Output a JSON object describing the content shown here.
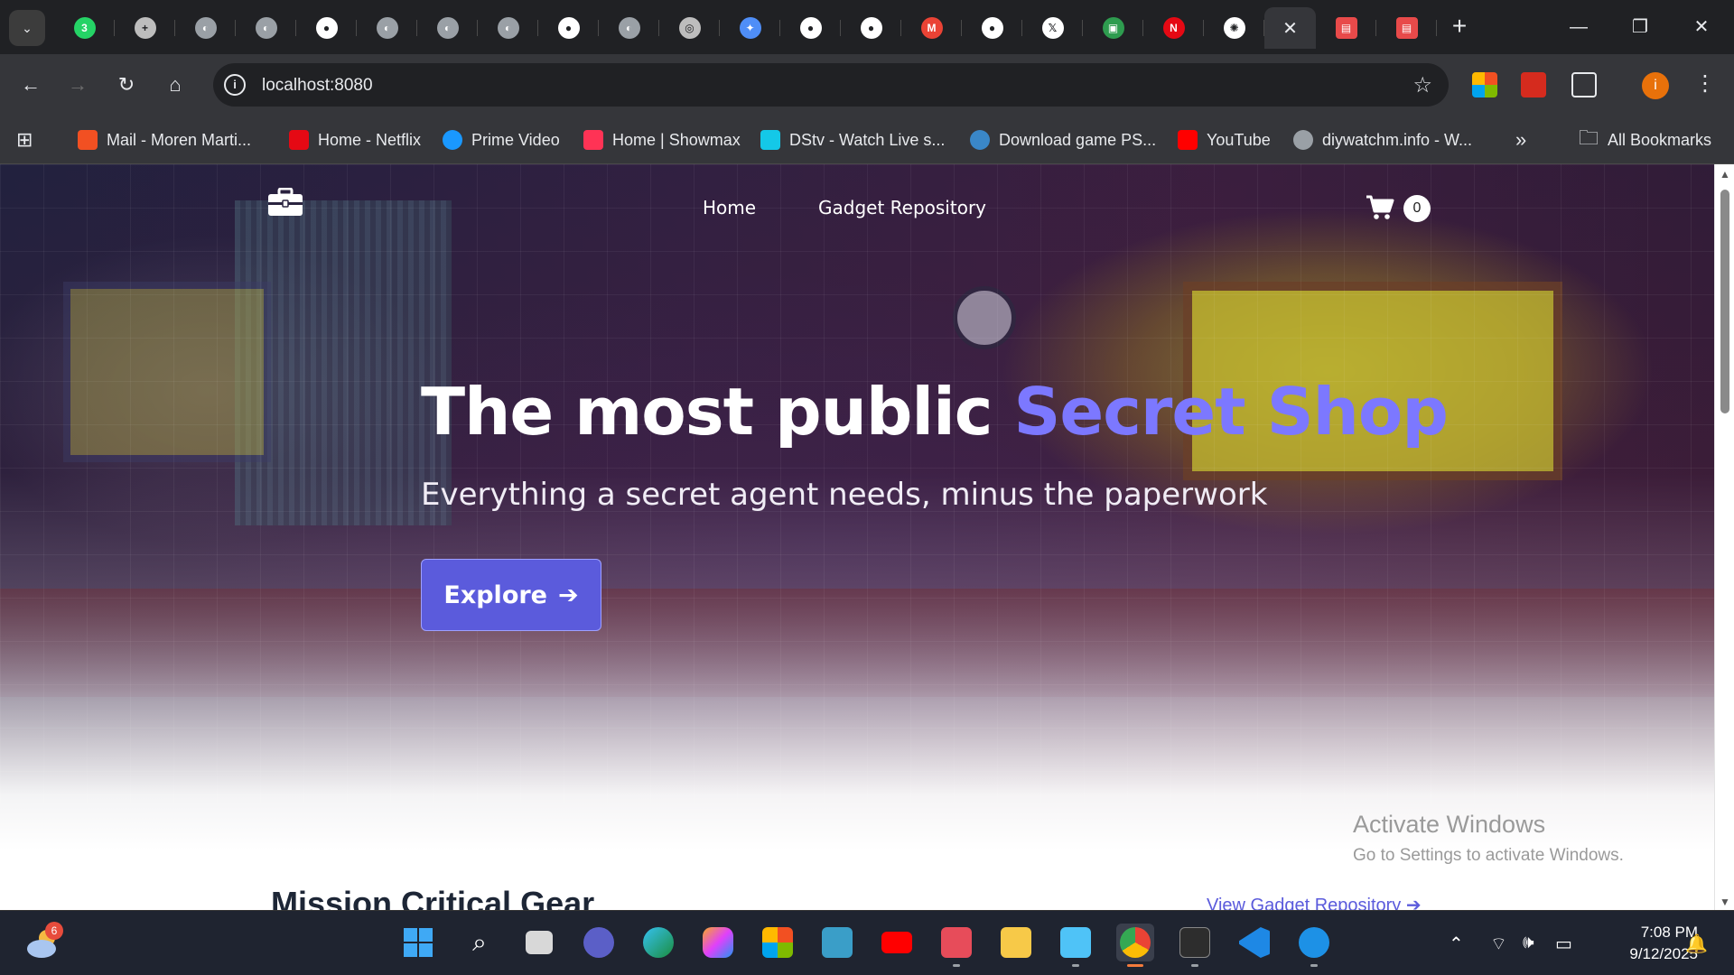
{
  "browser": {
    "tabs": [
      {
        "icon": "whatsapp-icon",
        "color": "#25d366",
        "glyph": "3"
      },
      {
        "icon": "tab-plus-icon",
        "color": "#bdbdbd",
        "glyph": "+"
      },
      {
        "icon": "globe-icon",
        "color": "#9aa0a6",
        "glyph": "◐"
      },
      {
        "icon": "globe-icon",
        "color": "#9aa0a6",
        "glyph": "◐"
      },
      {
        "icon": "github-icon",
        "color": "#ffffff",
        "glyph": "●"
      },
      {
        "icon": "globe-icon",
        "color": "#9aa0a6",
        "glyph": "◐"
      },
      {
        "icon": "globe-icon",
        "color": "#9aa0a6",
        "glyph": "◐"
      },
      {
        "icon": "globe-icon",
        "color": "#9aa0a6",
        "glyph": "◐"
      },
      {
        "icon": "github-icon",
        "color": "#ffffff",
        "glyph": "●"
      },
      {
        "icon": "globe-icon",
        "color": "#9aa0a6",
        "glyph": "◐"
      },
      {
        "icon": "chrome-icon",
        "color": "#bdbdbd",
        "glyph": "◎"
      },
      {
        "icon": "gemini-icon",
        "color": "#4f8ef7",
        "glyph": "✦"
      },
      {
        "icon": "github-icon",
        "color": "#ffffff",
        "glyph": "●"
      },
      {
        "icon": "github-icon",
        "color": "#ffffff",
        "glyph": "●"
      },
      {
        "icon": "gmail-icon",
        "color": "#ea4335",
        "glyph": "M"
      },
      {
        "icon": "github-icon",
        "color": "#ffffff",
        "glyph": "●"
      },
      {
        "icon": "x-icon",
        "color": "#ffffff",
        "glyph": "𝕏"
      },
      {
        "icon": "sheet-icon",
        "color": "#2e9c4f",
        "glyph": "▣"
      },
      {
        "icon": "netflix-icon",
        "color": "#e50914",
        "glyph": "N"
      },
      {
        "icon": "openai-icon",
        "color": "#ffffff",
        "glyph": "✺"
      }
    ],
    "active_tab_close": "✕",
    "after_tabs": [
      {
        "icon": "pdf-icon",
        "color": "#e84a4a",
        "glyph": "▤"
      },
      {
        "icon": "pdf-icon",
        "color": "#e84a4a",
        "glyph": "▤"
      }
    ],
    "new_tab": "+",
    "url": "localhost:8080",
    "profile_initial": "i",
    "bookmarks": [
      {
        "label": "Mail - Moren Marti...",
        "icon": "microsoft-icon",
        "color": "#f25022"
      },
      {
        "label": "Home - Netflix",
        "icon": "netflix-icon",
        "color": "#e50914"
      },
      {
        "label": "Prime Video",
        "icon": "prime-video-icon",
        "color": "#1a98ff"
      },
      {
        "label": "Home | Showmax",
        "icon": "showmax-icon",
        "color": "#ff3355"
      },
      {
        "label": "DStv - Watch Live s...",
        "icon": "dstv-icon",
        "color": "#14c8e8"
      },
      {
        "label": "Download game PS...",
        "icon": "wordpress-icon",
        "color": "#3a87c8"
      },
      {
        "label": "YouTube",
        "icon": "youtube-icon",
        "color": "#ff0000"
      },
      {
        "label": "diywatchm.info - W...",
        "icon": "globe-icon",
        "color": "#9aa0a6"
      }
    ],
    "more_bookmarks": "»",
    "all_bookmarks": "All Bookmarks"
  },
  "site": {
    "nav": {
      "links": [
        "Home",
        "Gadget Repository"
      ],
      "cart_count": "0"
    },
    "hero": {
      "title_main": "The most public ",
      "title_accent": "Secret Shop",
      "subtitle": "Everything a secret agent needs, minus the paperwork",
      "cta": "Explore",
      "cta_arrow": "➔",
      "accent_color": "#7c78ff"
    },
    "section": {
      "title": "Mission Critical Gear",
      "link": "View Gadget Repository",
      "link_arrow": "➔"
    }
  },
  "watermark": {
    "line1": "Activate Windows",
    "line2": "Go to Settings to activate Windows."
  },
  "taskbar": {
    "weather_badge": "6",
    "time": "7:08 PM",
    "date": "9/12/2025"
  }
}
